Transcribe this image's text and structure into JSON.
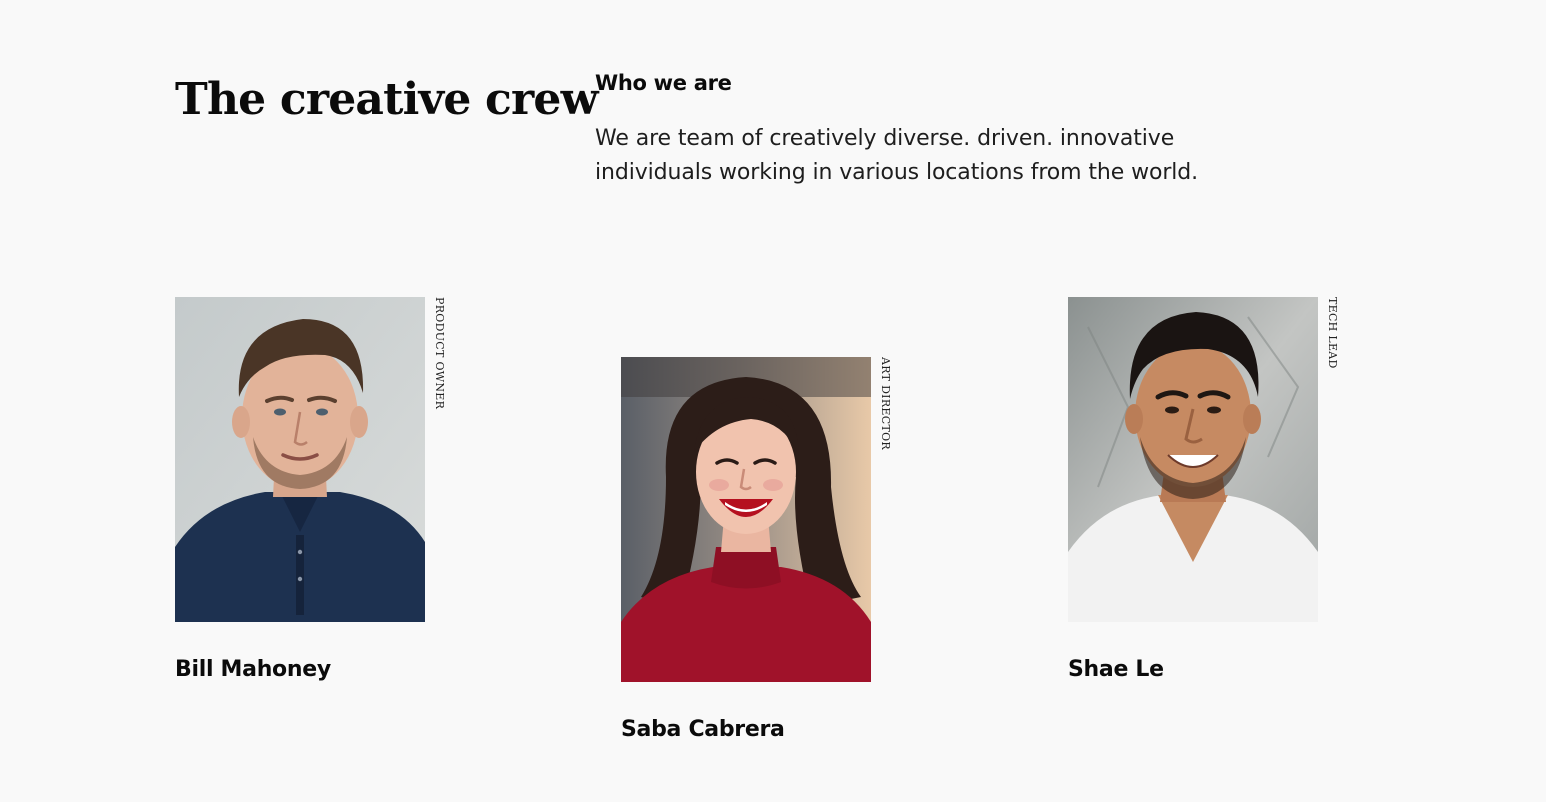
{
  "section": {
    "title": "The creative crew",
    "who_heading": "Who we are",
    "who_text": "We are team of creatively diverse. driven. innovative individuals working in various locations from the world."
  },
  "members": [
    {
      "name": "Bill Mahoney",
      "role": "PRODUCT OWNER"
    },
    {
      "name": "Saba Cabrera",
      "role": "ART DIRECTOR"
    },
    {
      "name": "Shae Le",
      "role": "TECH LEAD"
    }
  ],
  "colors": {
    "background": "#f9f9f9",
    "text": "#0b0b0b"
  }
}
